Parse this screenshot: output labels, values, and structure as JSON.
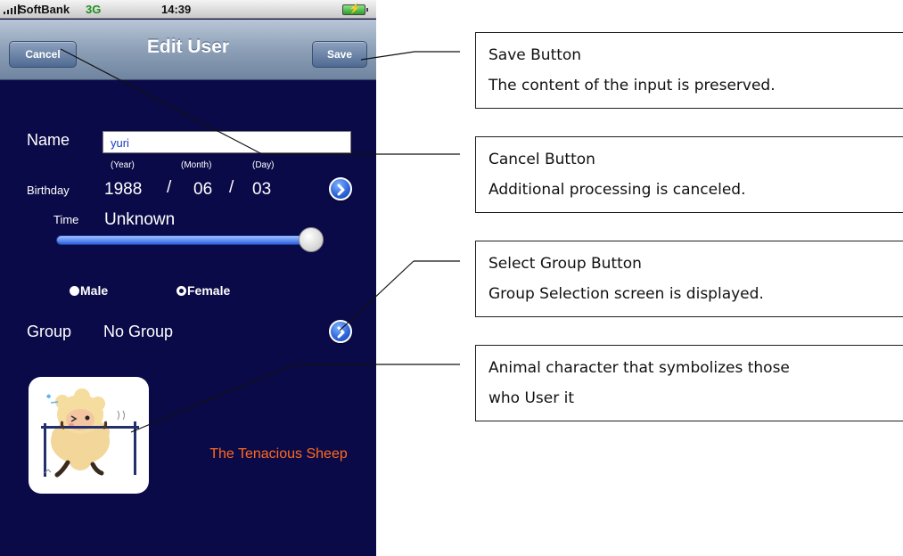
{
  "status_bar": {
    "carrier": "SoftBank",
    "network": "3G",
    "time": "14:39",
    "icons": [
      "signal-icon",
      "battery-charging-icon"
    ]
  },
  "nav_bar": {
    "title": "Edit User",
    "cancel_label": "Cancel",
    "save_label": "Save"
  },
  "form": {
    "name_label": "Name",
    "name_value": "yuri",
    "birthday_label": "Birthday",
    "year_caption": "(Year)",
    "month_caption": "(Month)",
    "day_caption": "(Day)",
    "year": "1988",
    "month": "06",
    "day": "03",
    "separator": "/",
    "time_label": "Time",
    "time_value": "Unknown",
    "time_slider_level": 1.0,
    "gender": {
      "male_label": "Male",
      "female_label": "Female",
      "selected": "Male"
    },
    "group_label": "Group",
    "group_value": "No Group"
  },
  "character": {
    "name": "The Tenacious Sheep",
    "icon": "sheep-character-icon"
  },
  "colors": {
    "screen_background": "#0b0a48",
    "accent_orange": "#ff6a1a",
    "name_text": "#1b3dbe"
  },
  "callouts": [
    {
      "title": "Save Button",
      "text": "The content of the input is preserved."
    },
    {
      "title": "Cancel Button",
      "text": "Additional processing is canceled."
    },
    {
      "title": "Select Group Button",
      "text": "Group Selection screen is displayed."
    },
    {
      "title": "Animal character that symbolizes those",
      "text": "who User it"
    }
  ]
}
